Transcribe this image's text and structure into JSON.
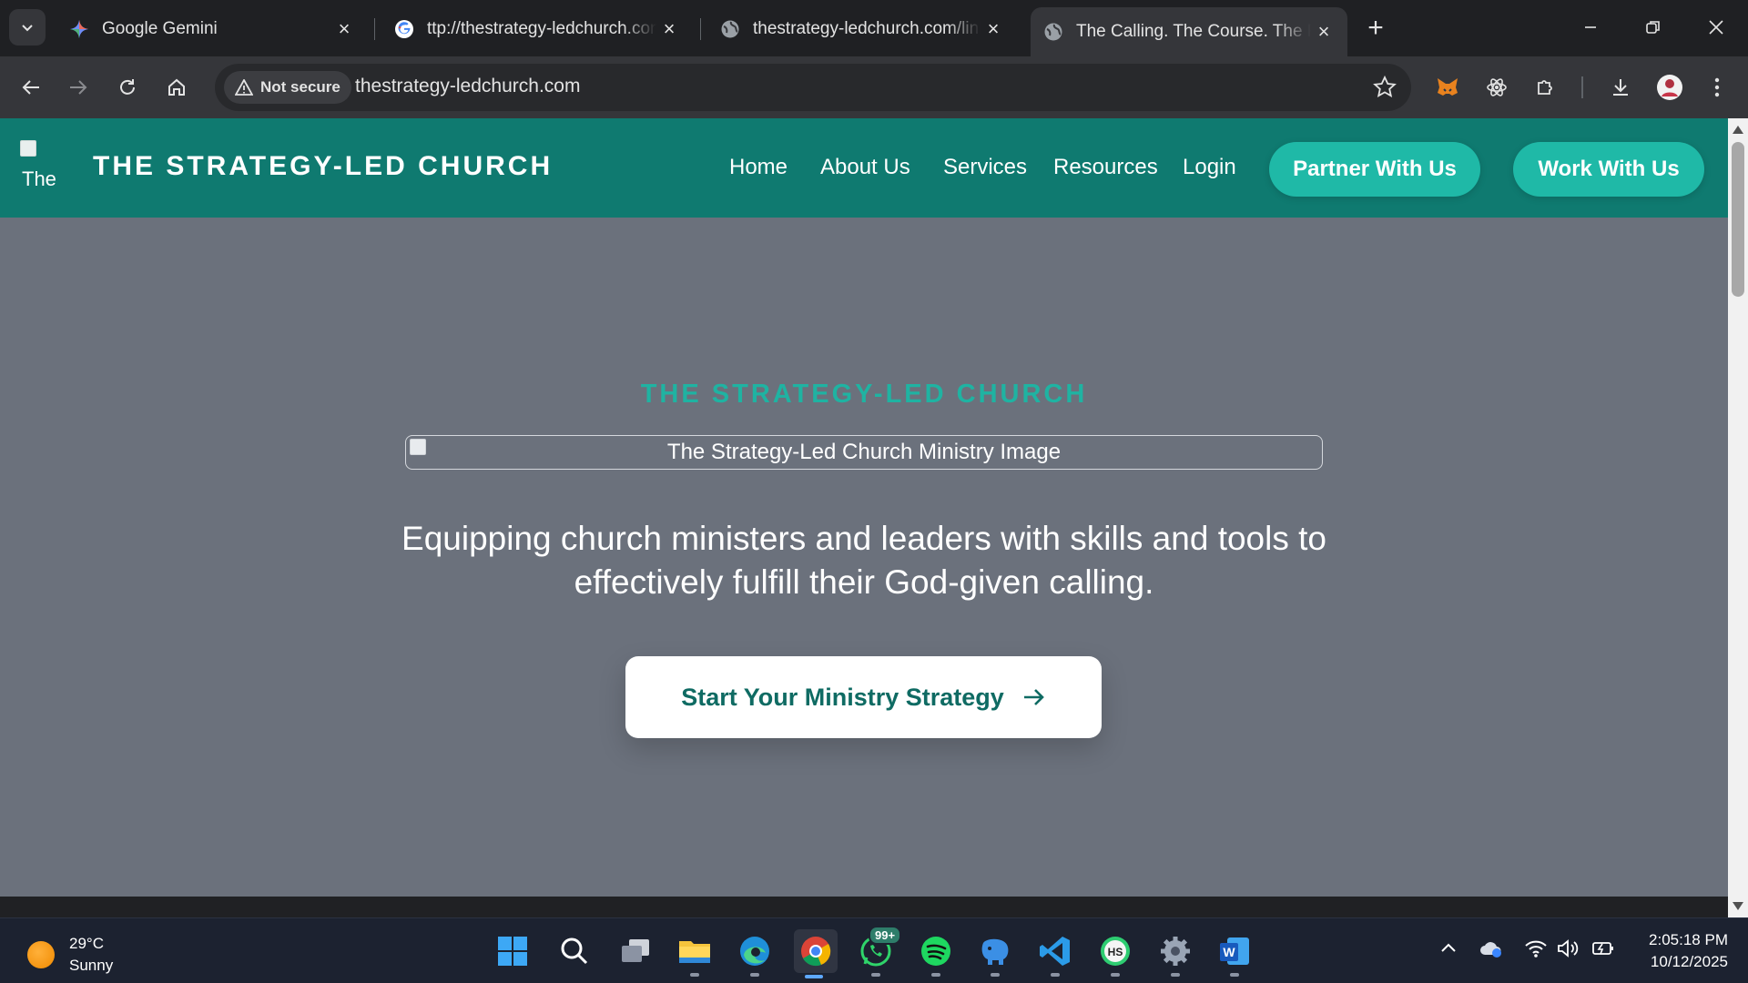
{
  "browser": {
    "tabs": [
      {
        "title": "Google Gemini",
        "icon": "gemini-icon"
      },
      {
        "title": "ttp://thestrategy-ledchurch.com",
        "icon": "google-icon"
      },
      {
        "title": "thestrategy-ledchurch.com/link",
        "icon": "globe-icon"
      },
      {
        "title": "The Calling. The Course. The Race",
        "icon": "globe-icon",
        "active": true
      }
    ],
    "address": {
      "security_label": "Not secure",
      "url": "thestrategy-ledchurch.com"
    }
  },
  "site": {
    "logo_alt": "The",
    "brand": "THE STRATEGY-LED CHURCH",
    "nav": {
      "home": "Home",
      "about": "About Us",
      "services": "Services",
      "resources": "Resources",
      "login": "Login"
    },
    "partner_button": "Partner With Us",
    "work_button": "Work With Us",
    "hero": {
      "eyebrow": "THE STRATEGY-LED CHURCH",
      "image_alt": "The Strategy-Led Church Ministry Image",
      "tagline": "Equipping church ministers and leaders with skills and tools to effectively fulfill their God-given calling.",
      "cta": "Start Your Ministry Strategy"
    },
    "colors": {
      "header": "#0f7a70",
      "accent": "#1fb9a7",
      "hero_bg": "#6b717c"
    }
  },
  "taskbar": {
    "weather": {
      "temp": "29°C",
      "condition": "Sunny"
    },
    "whatsapp_badge": "99+",
    "clock": {
      "time": "2:05:18 PM",
      "date": "10/12/2025"
    }
  }
}
